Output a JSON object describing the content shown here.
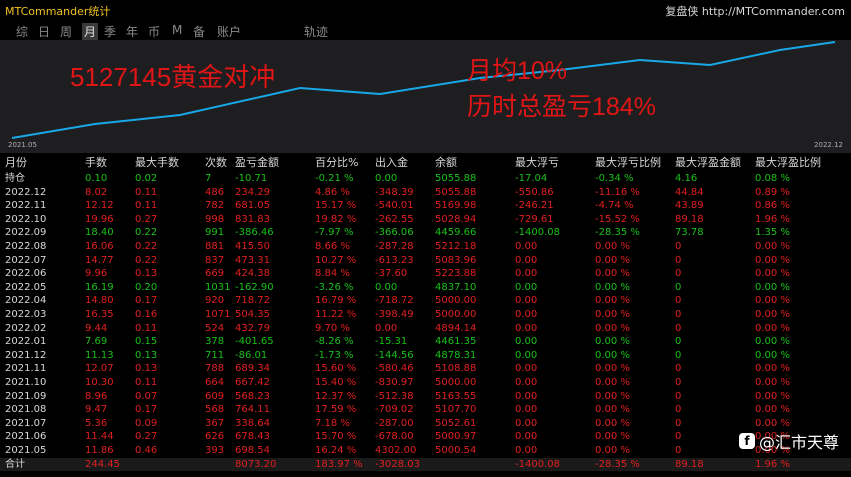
{
  "app_title": "MTCommander统计",
  "site_label": "复盘侠 http://MTCommander.com",
  "tabs": [
    {
      "label": "综",
      "active": false
    },
    {
      "label": "日",
      "active": false
    },
    {
      "label": "周",
      "active": false
    },
    {
      "label": "月",
      "active": true
    },
    {
      "label": "季",
      "active": false
    },
    {
      "label": "年",
      "active": false
    },
    {
      "label": "币",
      "active": false
    },
    {
      "label": "M",
      "active": false
    },
    {
      "label": "备",
      "active": false
    },
    {
      "label": "账户",
      "active": false
    },
    {
      "label": "轨迹",
      "active": false
    }
  ],
  "chart": {
    "start_date": "2021.05",
    "end_date": "2022.12",
    "line_color": "#18a8e8",
    "equity_values": [
      4302,
      5004.54,
      5000.97,
      5052.61,
      5107.7,
      5163.55,
      5000,
      5108.88,
      4878.31,
      4461.35,
      4894.14,
      5000,
      5000,
      4837.1,
      5223.88,
      5083.96,
      5212.18,
      4459.66,
      5028.94,
      5169.98,
      5055.88,
      5055.88
    ]
  },
  "overlay": {
    "title": "5127145黄金对冲",
    "monthly": "月均10%",
    "total": "历时总盈亏184%"
  },
  "headers": [
    "月份",
    "手数",
    "最大手数",
    "次数",
    "盈亏金额",
    "百分比%",
    "出入金",
    "余额",
    "最大浮亏",
    "最大浮亏比例",
    "最大浮盈金额",
    "最大浮盈比例"
  ],
  "rows": [
    [
      "持仓",
      "0.10",
      "0.02",
      "7",
      "-10.71",
      "-0.21 %",
      "0.00",
      "5055.88",
      "-17.04",
      "-0.34 %",
      "4.16",
      "0.08 %"
    ],
    [
      "2022.12",
      "8.02",
      "0.11",
      "486",
      "234.29",
      "4.86 %",
      "-348.39",
      "5055.88",
      "-550.86",
      "-11.16 %",
      "44.84",
      "0.89 %"
    ],
    [
      "2022.11",
      "12.12",
      "0.11",
      "782",
      "681.05",
      "15.17 %",
      "-540.01",
      "5169.98",
      "-246.21",
      "-4.74 %",
      "43.89",
      "0.86 %"
    ],
    [
      "2022.10",
      "19.96",
      "0.27",
      "998",
      "831.83",
      "19.82 %",
      "-262.55",
      "5028.94",
      "-729.61",
      "-15.52 %",
      "89.18",
      "1.96 %"
    ],
    [
      "2022.09",
      "18.40",
      "0.22",
      "991",
      "-386.46",
      "-7.97 %",
      "-366.06",
      "4459.66",
      "-1400.08",
      "-28.35 %",
      "73.78",
      "1.35 %"
    ],
    [
      "2022.08",
      "16.06",
      "0.22",
      "881",
      "415.50",
      "8.66 %",
      "-287.28",
      "5212.18",
      "0.00",
      "0.00 %",
      "0",
      "0.00 %"
    ],
    [
      "2022.07",
      "14.77",
      "0.22",
      "837",
      "473.31",
      "10.27 %",
      "-613.23",
      "5083.96",
      "0.00",
      "0.00 %",
      "0",
      "0.00 %"
    ],
    [
      "2022.06",
      "9.96",
      "0.13",
      "669",
      "424.38",
      "8.84 %",
      "-37.60",
      "5223.88",
      "0.00",
      "0.00 %",
      "0",
      "0.00 %"
    ],
    [
      "2022.05",
      "16.19",
      "0.20",
      "1031",
      "-162.90",
      "-3.26 %",
      "0.00",
      "4837.10",
      "0.00",
      "0.00 %",
      "0",
      "0.00 %"
    ],
    [
      "2022.04",
      "14.80",
      "0.17",
      "920",
      "718.72",
      "16.79 %",
      "-718.72",
      "5000.00",
      "0.00",
      "0.00 %",
      "0",
      "0.00 %"
    ],
    [
      "2022.03",
      "16.35",
      "0.16",
      "1071",
      "504.35",
      "11.22 %",
      "-398.49",
      "5000.00",
      "0.00",
      "0.00 %",
      "0",
      "0.00 %"
    ],
    [
      "2022.02",
      "9.44",
      "0.11",
      "524",
      "432.79",
      "9.70 %",
      "0.00",
      "4894.14",
      "0.00",
      "0.00 %",
      "0",
      "0.00 %"
    ],
    [
      "2022.01",
      "7.69",
      "0.15",
      "378",
      "-401.65",
      "-8.26 %",
      "-15.31",
      "4461.35",
      "0.00",
      "0.00 %",
      "0",
      "0.00 %"
    ],
    [
      "2021.12",
      "11.13",
      "0.13",
      "711",
      "-86.01",
      "-1.73 %",
      "-144.56",
      "4878.31",
      "0.00",
      "0.00 %",
      "0",
      "0.00 %"
    ],
    [
      "2021.11",
      "12.07",
      "0.13",
      "788",
      "689.34",
      "15.60 %",
      "-580.46",
      "5108.88",
      "0.00",
      "0.00 %",
      "0",
      "0.00 %"
    ],
    [
      "2021.10",
      "10.30",
      "0.11",
      "664",
      "667.42",
      "15.40 %",
      "-830.97",
      "5000.00",
      "0.00",
      "0.00 %",
      "0",
      "0.00 %"
    ],
    [
      "2021.09",
      "8.96",
      "0.07",
      "609",
      "568.23",
      "12.37 %",
      "-512.38",
      "5163.55",
      "0.00",
      "0.00 %",
      "0",
      "0.00 %"
    ],
    [
      "2021.08",
      "9.47",
      "0.17",
      "568",
      "764.11",
      "17.59 %",
      "-709.02",
      "5107.70",
      "0.00",
      "0.00 %",
      "0",
      "0.00 %"
    ],
    [
      "2021.07",
      "5.36",
      "0.09",
      "367",
      "338.64",
      "7.18 %",
      "-287.00",
      "5052.61",
      "0.00",
      "0.00 %",
      "0",
      "0.00 %"
    ],
    [
      "2021.06",
      "11.44",
      "0.27",
      "626",
      "678.43",
      "15.70 %",
      "-678.00",
      "5000.97",
      "0.00",
      "0.00 %",
      "0",
      "0.00 %"
    ],
    [
      "2021.05",
      "11.86",
      "0.46",
      "393",
      "698.54",
      "16.24 %",
      "4302.00",
      "5000.54",
      "0.00",
      "0.00 %",
      "0",
      "0.00 %"
    ],
    [
      "合计",
      "244.45",
      "",
      "",
      "8073.20",
      "183.97 %",
      "-3028.03",
      "",
      "-1400.08",
      "-28.35 %",
      "89.18",
      "1.96 %"
    ]
  ],
  "row_colors": [
    "neg",
    "pos",
    "pos",
    "pos",
    "neg",
    "pos",
    "pos",
    "pos",
    "neg",
    "pos",
    "pos",
    "pos",
    "neg",
    "neg",
    "pos",
    "pos",
    "pos",
    "pos",
    "pos",
    "pos",
    "pos",
    "pos"
  ],
  "watermark": "@汇市天尊"
}
